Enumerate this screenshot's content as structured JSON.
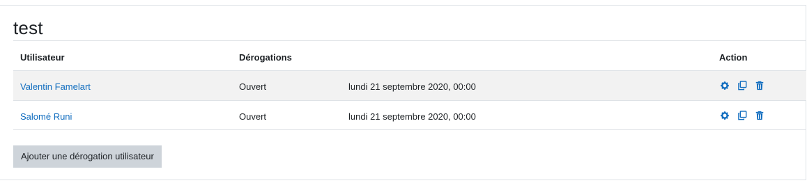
{
  "page": {
    "title": "test",
    "add_button_label": "Ajouter une dérogation utilisateur"
  },
  "table": {
    "headers": {
      "user": "Utilisateur",
      "overrides": "Dérogations",
      "action": "Action"
    },
    "rows": [
      {
        "user": "Valentin Famelart",
        "status": "Ouvert",
        "date": "lundi 21 septembre 2020, 00:00"
      },
      {
        "user": "Salomé Runi",
        "status": "Ouvert",
        "date": "lundi 21 septembre 2020, 00:00"
      }
    ],
    "action_icons": [
      "gear-icon",
      "copy-icon",
      "trash-icon"
    ]
  },
  "colors": {
    "link": "#0f6cbf",
    "button_bg": "#ced4da",
    "stripe": "#f2f2f2",
    "border": "#dee2e6"
  }
}
